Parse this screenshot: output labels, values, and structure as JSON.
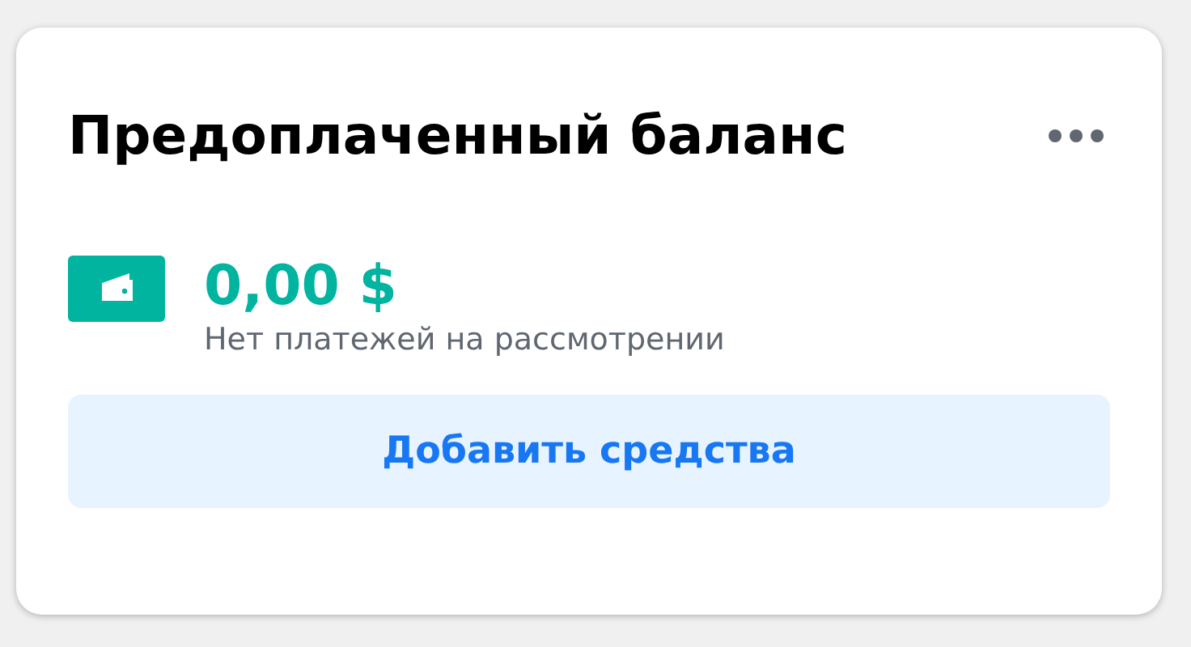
{
  "card": {
    "title": "Предоплаченный баланс",
    "balance": "0,00 $",
    "status": "Нет платежей на рассмотрении",
    "button": "Добавить средства"
  }
}
